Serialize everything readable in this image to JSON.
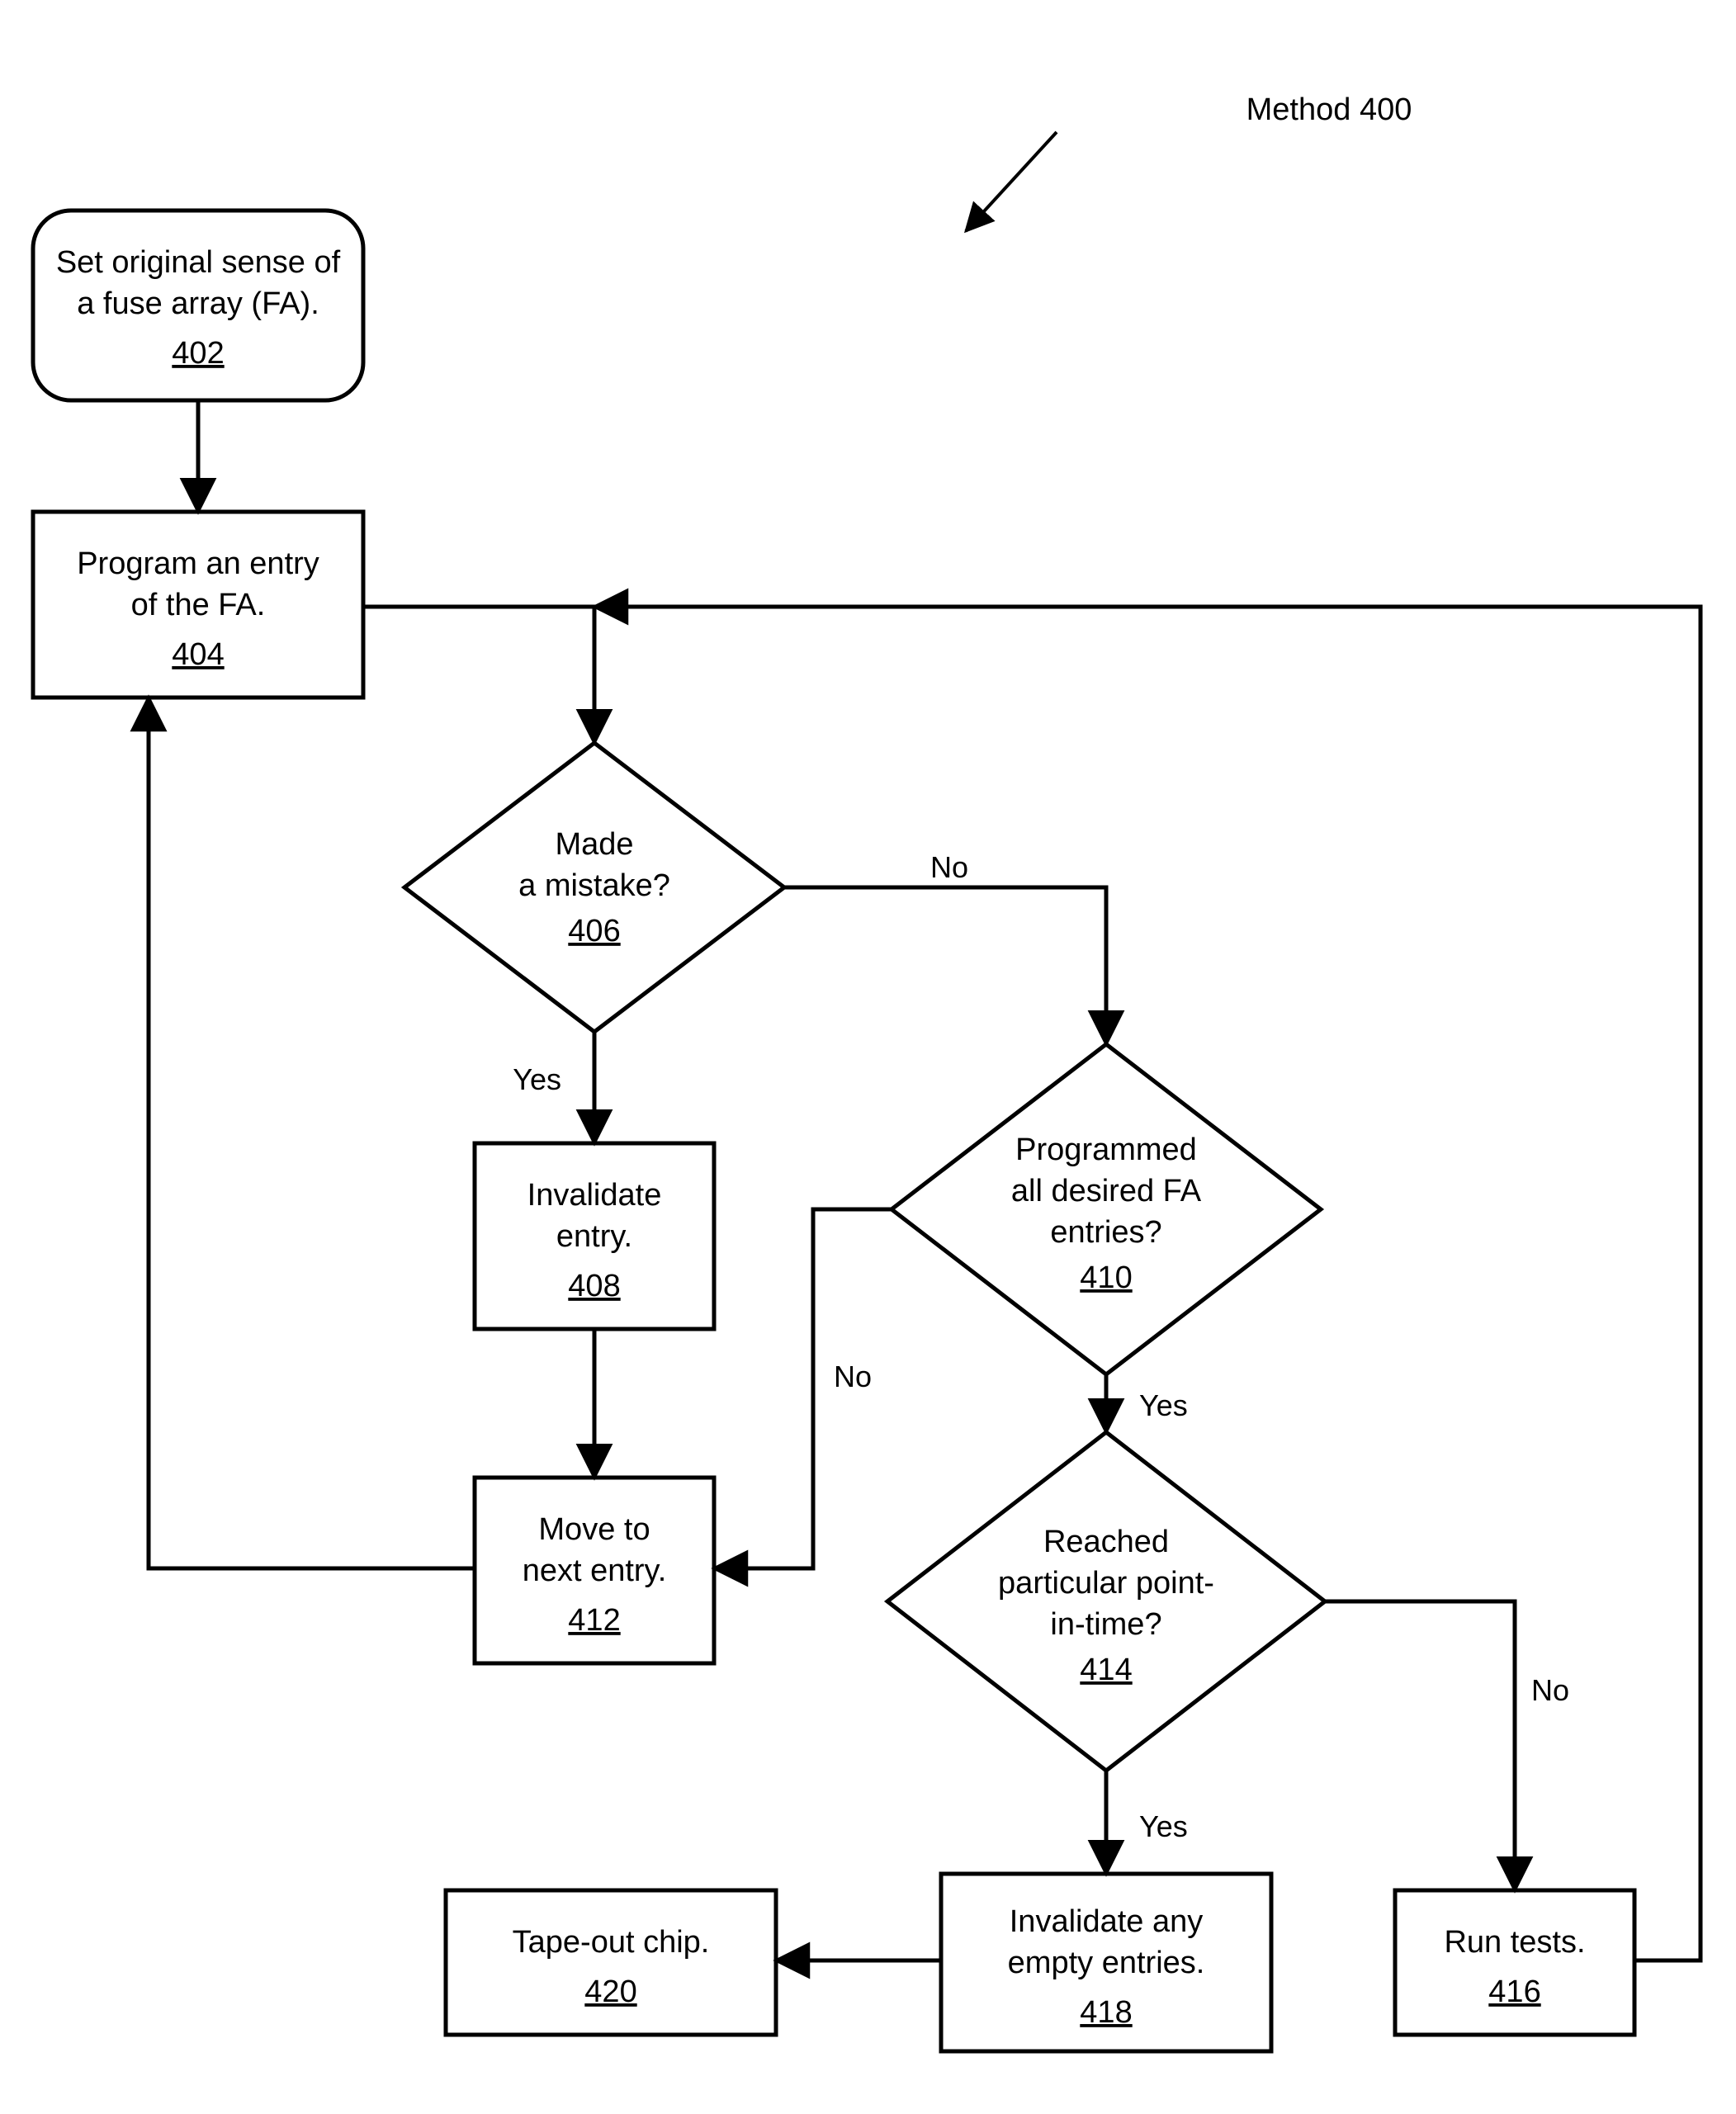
{
  "title": {
    "label": "Method 400"
  },
  "nodes": {
    "n402": {
      "l1": "Set original sense of",
      "l2": "a fuse array (FA).",
      "ref": "402"
    },
    "n404": {
      "l1": "Program an entry",
      "l2": "of the FA.",
      "ref": "404"
    },
    "n406": {
      "l1": "Made",
      "l2": "a mistake?",
      "ref": "406"
    },
    "n408": {
      "l1": "Invalidate",
      "l2": "entry.",
      "ref": "408"
    },
    "n410": {
      "l1": "Programmed",
      "l2": "all desired FA",
      "l3": "entries?",
      "ref": "410"
    },
    "n412": {
      "l1": "Move to",
      "l2": "next entry.",
      "ref": "412"
    },
    "n414": {
      "l1": "Reached",
      "l2": "particular point-",
      "l3": "in-time?",
      "ref": "414"
    },
    "n416": {
      "l1": "Run tests.",
      "ref": "416"
    },
    "n418": {
      "l1": "Invalidate any",
      "l2": "empty entries.",
      "ref": "418"
    },
    "n420": {
      "l1": "Tape-out chip.",
      "ref": "420"
    }
  },
  "edges": {
    "yes": "Yes",
    "no": "No"
  }
}
